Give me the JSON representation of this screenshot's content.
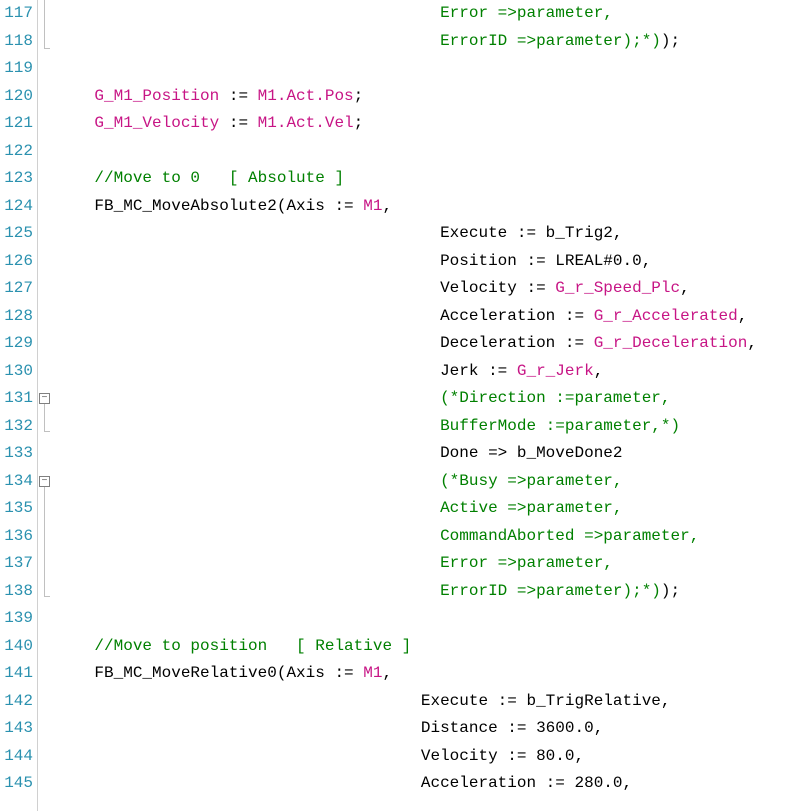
{
  "startLine": 117,
  "lines": {
    "l117": {
      "num": "117",
      "indent": "                                        ",
      "tokens": [
        {
          "t": "Error =>parameter,",
          "c": "green"
        }
      ]
    },
    "l118": {
      "num": "118",
      "indent": "                                        ",
      "tokens": [
        {
          "t": "ErrorID =>parameter);*)",
          "c": "green"
        },
        {
          "t": ");",
          "c": "black"
        }
      ]
    },
    "l119": {
      "num": "119",
      "indent": "",
      "tokens": []
    },
    "l120": {
      "num": "120",
      "indent": "    ",
      "tokens": [
        {
          "t": "G_M1_Position",
          "c": "magenta"
        },
        {
          "t": " := ",
          "c": "black"
        },
        {
          "t": "M1.Act.Pos",
          "c": "magenta"
        },
        {
          "t": ";",
          "c": "black"
        }
      ]
    },
    "l121": {
      "num": "121",
      "indent": "    ",
      "tokens": [
        {
          "t": "G_M1_Velocity",
          "c": "magenta"
        },
        {
          "t": " := ",
          "c": "black"
        },
        {
          "t": "M1.Act.Vel",
          "c": "magenta"
        },
        {
          "t": ";",
          "c": "black"
        }
      ]
    },
    "l122": {
      "num": "122",
      "indent": "",
      "tokens": []
    },
    "l123": {
      "num": "123",
      "indent": "    ",
      "tokens": [
        {
          "t": "//Move to 0   [ Absolute ]",
          "c": "green"
        }
      ]
    },
    "l124": {
      "num": "124",
      "indent": "    ",
      "tokens": [
        {
          "t": "FB_MC_MoveAbsolute2(Axis := ",
          "c": "black"
        },
        {
          "t": "M1",
          "c": "magenta"
        },
        {
          "t": ",",
          "c": "black"
        }
      ]
    },
    "l125": {
      "num": "125",
      "indent": "                                        ",
      "tokens": [
        {
          "t": "Execute := b_Trig2,",
          "c": "black"
        }
      ]
    },
    "l126": {
      "num": "126",
      "indent": "                                        ",
      "tokens": [
        {
          "t": "Position := LREAL#0.0,",
          "c": "black"
        }
      ]
    },
    "l127": {
      "num": "127",
      "indent": "                                        ",
      "tokens": [
        {
          "t": "Velocity := ",
          "c": "black"
        },
        {
          "t": "G_r_Speed_Plc",
          "c": "magenta"
        },
        {
          "t": ",",
          "c": "black"
        }
      ]
    },
    "l128": {
      "num": "128",
      "indent": "                                        ",
      "tokens": [
        {
          "t": "Acceleration := ",
          "c": "black"
        },
        {
          "t": "G_r_Accelerated",
          "c": "magenta"
        },
        {
          "t": ",",
          "c": "black"
        }
      ]
    },
    "l129": {
      "num": "129",
      "indent": "                                        ",
      "tokens": [
        {
          "t": "Deceleration := ",
          "c": "black"
        },
        {
          "t": "G_r_Deceleration",
          "c": "magenta"
        },
        {
          "t": ",",
          "c": "black"
        }
      ]
    },
    "l130": {
      "num": "130",
      "indent": "                                        ",
      "tokens": [
        {
          "t": "Jerk := ",
          "c": "black"
        },
        {
          "t": "G_r_Jerk",
          "c": "magenta"
        },
        {
          "t": ",",
          "c": "black"
        }
      ]
    },
    "l131": {
      "num": "131",
      "indent": "                                        ",
      "tokens": [
        {
          "t": "(*Direction :=parameter,",
          "c": "green"
        }
      ]
    },
    "l132": {
      "num": "132",
      "indent": "                                        ",
      "tokens": [
        {
          "t": "BufferMode :=parameter,*)",
          "c": "green"
        }
      ]
    },
    "l133": {
      "num": "133",
      "indent": "                                        ",
      "tokens": [
        {
          "t": "Done => b_MoveDone2",
          "c": "black"
        }
      ]
    },
    "l134": {
      "num": "134",
      "indent": "                                        ",
      "tokens": [
        {
          "t": "(*Busy =>parameter,",
          "c": "green"
        }
      ]
    },
    "l135": {
      "num": "135",
      "indent": "                                        ",
      "tokens": [
        {
          "t": "Active =>parameter,",
          "c": "green"
        }
      ]
    },
    "l136": {
      "num": "136",
      "indent": "                                        ",
      "tokens": [
        {
          "t": "CommandAborted =>parameter,",
          "c": "green"
        }
      ]
    },
    "l137": {
      "num": "137",
      "indent": "                                        ",
      "tokens": [
        {
          "t": "Error =>parameter,",
          "c": "green"
        }
      ]
    },
    "l138": {
      "num": "138",
      "indent": "                                        ",
      "tokens": [
        {
          "t": "ErrorID =>parameter);*)",
          "c": "green"
        },
        {
          "t": ");",
          "c": "black"
        }
      ]
    },
    "l139": {
      "num": "139",
      "indent": "",
      "tokens": []
    },
    "l140": {
      "num": "140",
      "indent": "    ",
      "tokens": [
        {
          "t": "//Move to position   [ Relative ]",
          "c": "green"
        }
      ]
    },
    "l141": {
      "num": "141",
      "indent": "    ",
      "tokens": [
        {
          "t": "FB_MC_MoveRelative0(Axis := ",
          "c": "black"
        },
        {
          "t": "M1",
          "c": "magenta"
        },
        {
          "t": ",",
          "c": "black"
        }
      ]
    },
    "l142": {
      "num": "142",
      "indent": "                                      ",
      "tokens": [
        {
          "t": "Execute := b_TrigRelative,",
          "c": "black"
        }
      ]
    },
    "l143": {
      "num": "143",
      "indent": "                                      ",
      "tokens": [
        {
          "t": "Distance := 3600.0,",
          "c": "black"
        }
      ]
    },
    "l144": {
      "num": "144",
      "indent": "                                      ",
      "tokens": [
        {
          "t": "Velocity := 80.0,",
          "c": "black"
        }
      ]
    },
    "l145": {
      "num": "145",
      "indent": "                                      ",
      "tokens": [
        {
          "t": "Acceleration := 280.0,",
          "c": "black"
        }
      ]
    }
  },
  "foldMarkers": {
    "l131": "−",
    "l134": "−"
  }
}
